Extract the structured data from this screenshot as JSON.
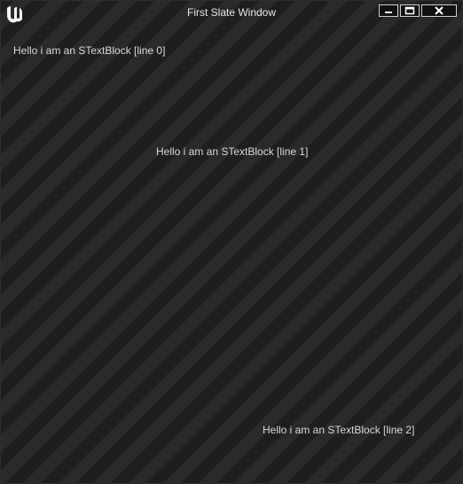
{
  "window": {
    "title": "First Slate Window",
    "logo_icon": "unreal-engine-logo",
    "controls": {
      "minimize_icon": "minimize-icon",
      "maximize_icon": "maximize-icon",
      "close_icon": "close-icon"
    }
  },
  "content": {
    "text_blocks": [
      "Hello i am an STextBlock [line 0]",
      "Hello i am an STextBlock [line 1]",
      "Hello i am an STextBlock [line 2]"
    ]
  },
  "colors": {
    "background_stripe_light": "#2a2a2a",
    "background_stripe_dark": "#1e1e1e",
    "text": "#d9d9d9"
  }
}
